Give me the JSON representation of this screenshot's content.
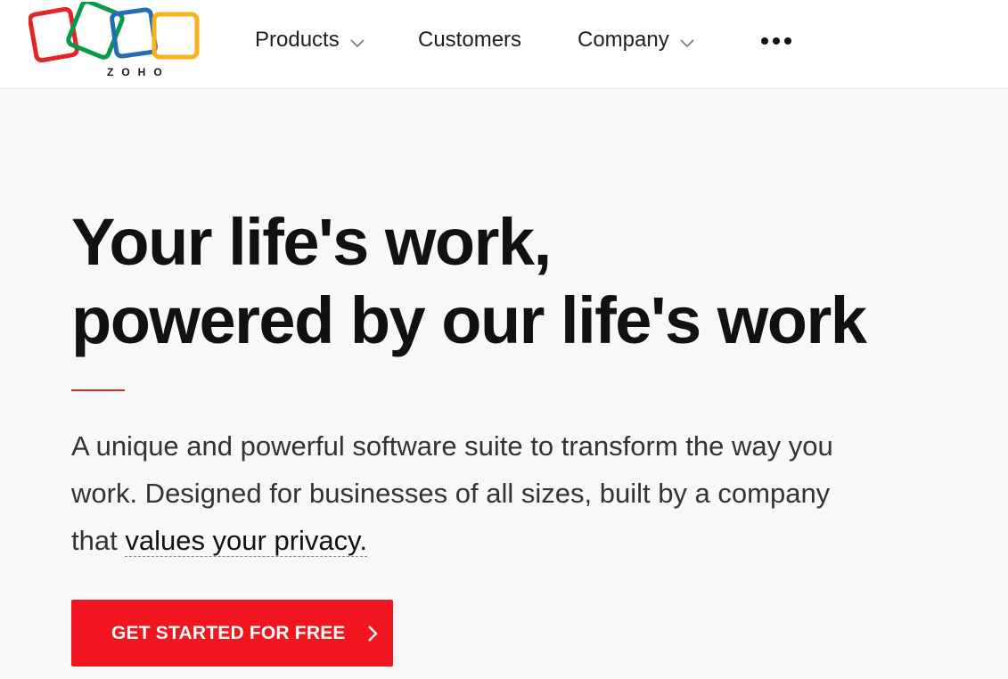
{
  "brand": {
    "wordmark": "ZOHO",
    "colors": {
      "red": "#e42527",
      "green": "#089949",
      "blue": "#226db4",
      "yellow": "#f9b21d"
    }
  },
  "nav": {
    "items": [
      {
        "label": "Products",
        "has_dropdown": true,
        "icon": "chevron-down-icon"
      },
      {
        "label": "Customers",
        "has_dropdown": false
      },
      {
        "label": "Company",
        "has_dropdown": true,
        "icon": "chevron-down-icon"
      }
    ],
    "more_icon": "more-dots-icon"
  },
  "hero": {
    "title_line1": "Your life's work,",
    "title_line2": "powered by our life's work",
    "description_pre": "A unique and powerful software suite to transform the way you work. Designed for businesses of all sizes, built by a company that ",
    "description_link": "values your privacy.",
    "cta_label": "GET STARTED FOR FREE",
    "cta_icon": "chevron-right-icon",
    "accent_color": "#f0151f"
  }
}
